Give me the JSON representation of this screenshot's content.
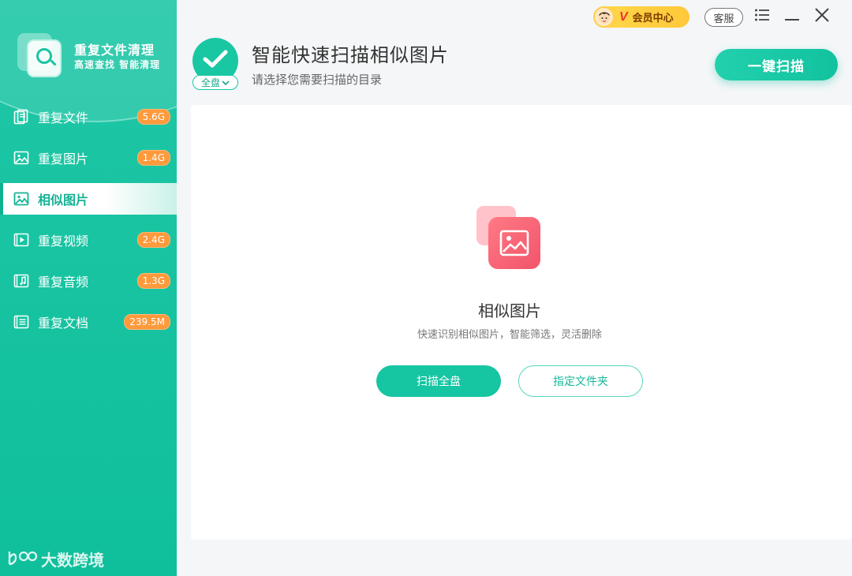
{
  "app": {
    "title": "重复文件清理",
    "subtitle": "高速查找 智能清理"
  },
  "sidebar": {
    "items": [
      {
        "label": "重复文件",
        "badge": "5.6G",
        "icon": "file-duplicate-icon",
        "active": false
      },
      {
        "label": "重复图片",
        "badge": "1.4G",
        "icon": "image-icon",
        "active": false
      },
      {
        "label": "相似图片",
        "badge": "",
        "icon": "image-icon",
        "active": true
      },
      {
        "label": "重复视频",
        "badge": "2.4G",
        "icon": "video-icon",
        "active": false
      },
      {
        "label": "重复音频",
        "badge": "1.3G",
        "icon": "music-icon",
        "active": false
      },
      {
        "label": "重复文档",
        "badge": "239.5M",
        "icon": "document-icon",
        "active": false
      }
    ],
    "watermark": "大数跨境"
  },
  "titlebar": {
    "vip_label": "会员中心",
    "vip_mark": "V",
    "service_label": "客服"
  },
  "header": {
    "title": "智能快速扫描相似图片",
    "subtitle": "请选择您需要扫描的目录",
    "scope": "全盘",
    "quick_scan_label": "一键扫描"
  },
  "main": {
    "title": "相似图片",
    "description": "快速识别相似图片，智能筛选，灵活删除",
    "scan_full_label": "扫描全盘",
    "choose_folder_label": "指定文件夹"
  },
  "colors": {
    "accent": "#16c5a2",
    "badge": "#ff9a3c",
    "hero": "#f2546a"
  }
}
